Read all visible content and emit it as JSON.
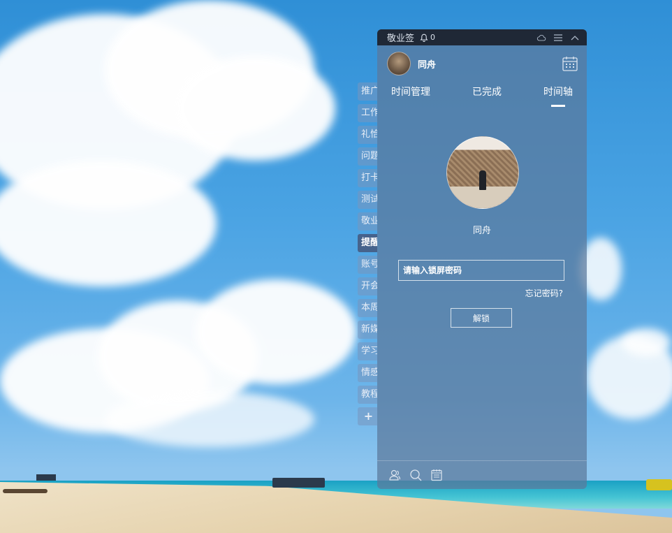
{
  "window": {
    "title": "敬业签",
    "notification_count": "0",
    "icons": [
      "bell-icon",
      "cloud-sync-icon",
      "menu-icon",
      "collapse-up-icon"
    ]
  },
  "user": {
    "name": "同舟",
    "avatar_icon": "avatar-photo",
    "calendar_icon": "calendar-icon"
  },
  "tabs": [
    {
      "label": "时间管理",
      "active": false
    },
    {
      "label": "已完成",
      "active": false
    },
    {
      "label": "时间轴",
      "active": true
    }
  ],
  "lock_screen": {
    "name": "同舟",
    "password_placeholder": "请输入锁屏密码",
    "forgot_label": "忘记密码?",
    "unlock_label": "解锁"
  },
  "side_tabs": [
    {
      "label": "推广",
      "color": "#5b7fa8"
    },
    {
      "label": "工作",
      "color": "#5b7fa8"
    },
    {
      "label": "礼恰",
      "color": "#5b7fa8"
    },
    {
      "label": "问题",
      "color": "#d0453a"
    },
    {
      "label": "打卡",
      "color": "#d0453a"
    },
    {
      "label": "测试",
      "color": "#d0453a"
    },
    {
      "label": "敬业",
      "color": "#d0453a"
    },
    {
      "label": "提醒",
      "color": "#3f5f8a"
    },
    {
      "label": "账号",
      "color": "#5b7fa8"
    },
    {
      "label": "开会",
      "color": "#5b7fa8"
    },
    {
      "label": "本周",
      "color": "#d0453a"
    },
    {
      "label": "新媒",
      "color": "#3f6fd0"
    },
    {
      "label": "学习",
      "color": "#5b7fa8"
    },
    {
      "label": "情感",
      "color": "#d0453a"
    },
    {
      "label": "教程",
      "color": "#3fa85b"
    },
    {
      "label": "+",
      "color": "#5b7fa8"
    }
  ],
  "bottom_bar": {
    "icons": [
      "contacts-icon",
      "search-icon",
      "notepad-icon"
    ]
  },
  "colors": {
    "titlebar": "#1f2836",
    "panel": "#5c789b"
  }
}
